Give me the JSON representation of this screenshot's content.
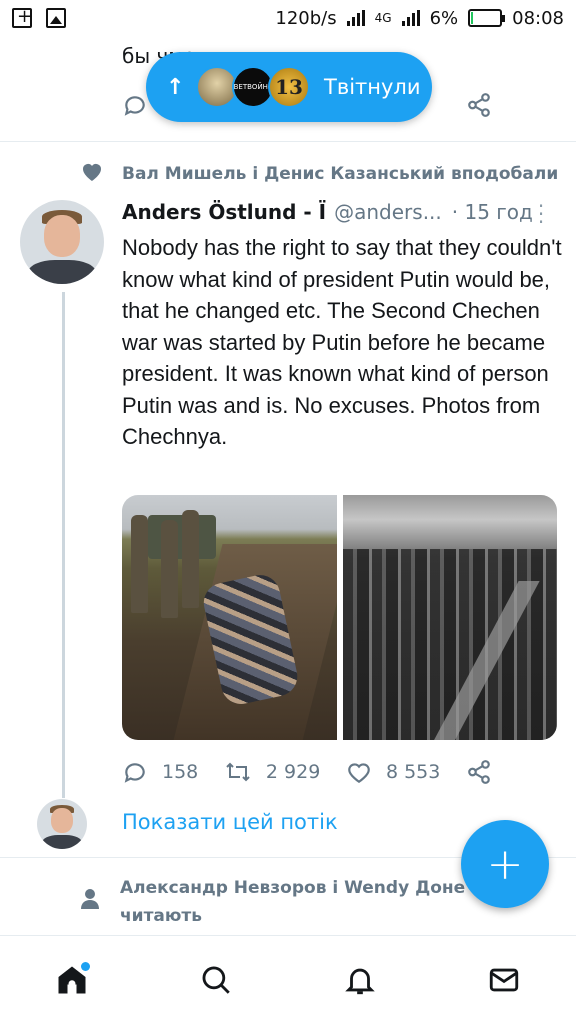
{
  "status_bar": {
    "speed": "120b/s",
    "network": "4G",
    "battery": "6%",
    "time": "08:08",
    "battery_level": 0.06,
    "battery_color": "#22c55e"
  },
  "prev_tweet": {
    "text_fragment": "бы                                                   чмо"
  },
  "new_tweets_pill": {
    "label": "Твітнули",
    "avatar2_text": "ВЕТВОЙНЕ",
    "avatar3_text": "13",
    "color": "#1da1f2"
  },
  "social_context": {
    "text": "Вал Мишель і Денис Казанський вподобали",
    "icon": "heart-icon"
  },
  "tweet": {
    "name": "Anders Östlund - Ї",
    "handle": "@anders...",
    "time": "· 15 год",
    "text": "Nobody has the right to say that they couldn't know what kind of president Putin would be, that he changed etc. The Second Chechen war was started by Putin before he became president. It was known what kind of person Putin was and is. No excuses. Photos from Chechnya.",
    "replies": "158",
    "retweets": "2 929",
    "likes": "8 553"
  },
  "show_thread": "Показати цей потік",
  "follow_context": {
    "line1": "Александр Невзоров і Wendy Доне",
    "line2": "читають"
  },
  "fab": "+",
  "colors": {
    "accent": "#1da1f2",
    "muted": "#657786",
    "text": "#14171a"
  }
}
